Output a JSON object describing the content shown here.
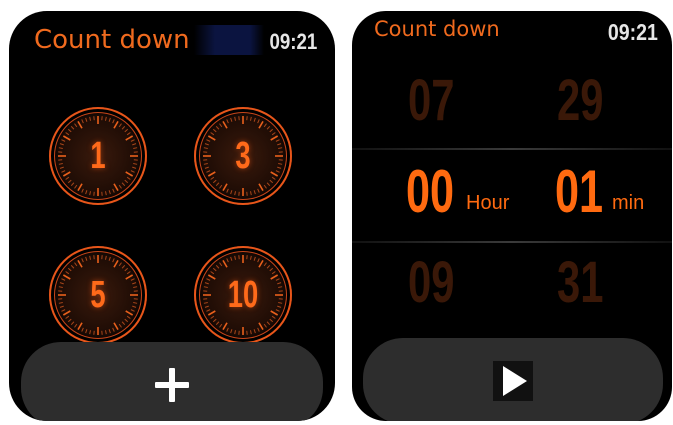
{
  "left_screen": {
    "title": "Count down",
    "time": "09:21",
    "presets": [
      {
        "label": "1"
      },
      {
        "label": "3"
      },
      {
        "label": "5"
      },
      {
        "label": "10"
      }
    ],
    "add_icon": "plus-icon"
  },
  "right_screen": {
    "title": "Count down",
    "time": "09:21",
    "hours": {
      "prev": "07",
      "current": "00",
      "next": "09",
      "unit": "Hour"
    },
    "minutes": {
      "prev": "29",
      "current": "01",
      "next": "31",
      "unit": "min"
    },
    "start_icon": "play-icon"
  },
  "colors": {
    "accent": "#ff6a10",
    "dim_digits": "#3a1808",
    "button_bg": "#2d2d2d",
    "screen_bg": "#000000"
  }
}
